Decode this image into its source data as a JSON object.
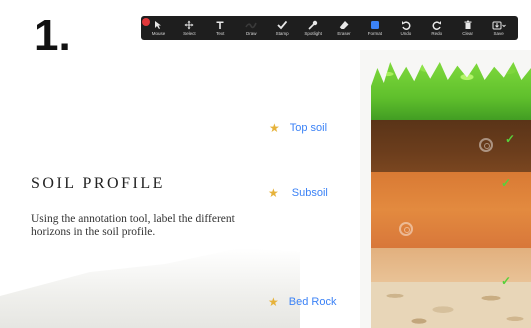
{
  "step_number": "1.",
  "toolbar": {
    "tools": [
      {
        "label": "Mouse",
        "icon": "mouse-pointer-icon"
      },
      {
        "label": "Select",
        "icon": "select-move-icon"
      },
      {
        "label": "Text",
        "icon": "text-icon"
      },
      {
        "label": "Draw",
        "icon": "draw-icon"
      },
      {
        "label": "Stamp",
        "icon": "stamp-check-icon"
      },
      {
        "label": "Spotlight",
        "icon": "spotlight-icon"
      },
      {
        "label": "Eraser",
        "icon": "eraser-icon"
      },
      {
        "label": "Format",
        "icon": "format-icon"
      },
      {
        "label": "Undo",
        "icon": "undo-icon"
      },
      {
        "label": "Redo",
        "icon": "redo-icon"
      },
      {
        "label": "Clear",
        "icon": "trash-icon"
      },
      {
        "label": "Save",
        "icon": "save-icon"
      }
    ],
    "accent": "#3b82f6"
  },
  "slide": {
    "title": "SOIL PROFILE",
    "description": "Using the annotation tool, label the different horizons in the soil profile.",
    "labels": {
      "top_soil": "Top soil",
      "subsoil": "Subsoil",
      "bed_rock": "Bed Rock"
    },
    "label_color": "#3b82f6",
    "star_color": "#e6b23a",
    "check_color": "#57d13b"
  }
}
